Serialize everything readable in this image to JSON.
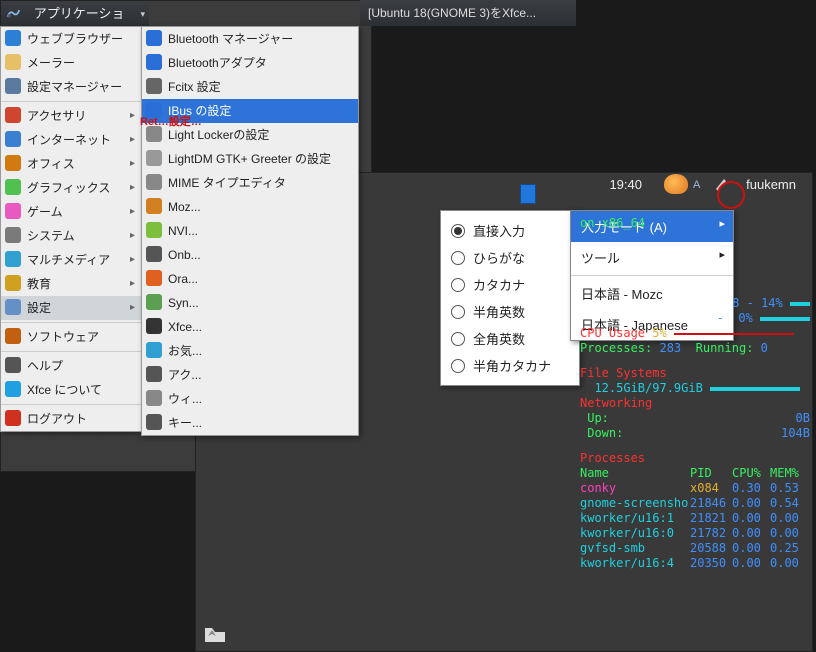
{
  "menubar": {
    "applications_label": "アプリケーション"
  },
  "window_title_1": "[Ubuntu 18(GNOME 3)をXfce...",
  "app_menu": {
    "items": [
      {
        "label": "ウェブブラウザー",
        "has_sub": false
      },
      {
        "label": "メーラー",
        "has_sub": false
      },
      {
        "label": "設定マネージャー",
        "has_sub": false
      },
      {
        "label": "アクセサリ",
        "has_sub": true
      },
      {
        "label": "インターネット",
        "has_sub": true
      },
      {
        "label": "オフィス",
        "has_sub": true
      },
      {
        "label": "グラフィックス",
        "has_sub": true
      },
      {
        "label": "ゲーム",
        "has_sub": true
      },
      {
        "label": "システム",
        "has_sub": true
      },
      {
        "label": "マルチメディア",
        "has_sub": true
      },
      {
        "label": "教育",
        "has_sub": true
      },
      {
        "label": "設定",
        "has_sub": true,
        "selected": true
      },
      {
        "label": "ソフトウェア",
        "has_sub": false
      },
      {
        "label": "ヘルプ",
        "has_sub": false
      },
      {
        "label": "Xfce について",
        "has_sub": false
      },
      {
        "label": "ログアウト",
        "has_sub": false
      }
    ],
    "icon_colors": [
      "#2b7fd4",
      "#e5c067",
      "#5a7aa0",
      "#d04530",
      "#3a80d0",
      "#d07a10",
      "#50c050",
      "#e85ac0",
      "#7a7a7a",
      "#30a0d0",
      "#d0a020",
      "#6590c5",
      "#c06010",
      "#555",
      "#20a0e0",
      "#d03020"
    ]
  },
  "submenu": {
    "items": [
      "Bluetooth マネージャー",
      "Bluetoothアダプタ",
      "Fcitx 設定",
      "IBus の設定",
      "Light Lockerの設定",
      "LightDM GTK+ Greeter の設定",
      "MIME タイプエディタ",
      "Moz...",
      "NVI...",
      "Onb...",
      "Ora...",
      "Syn...",
      "Xfce...",
      "お気...",
      "アク...",
      "ウィ...",
      "キー..."
    ],
    "highlight_index": 3,
    "icon_colors": [
      "#2a6fd8",
      "#2a6fd8",
      "#666",
      "#2a6fd8",
      "#888",
      "#999",
      "#888",
      "#d08020",
      "#7bbf3c",
      "#555",
      "#e06020",
      "#5aa050",
      "#333",
      "#30a0d0",
      "#555",
      "#888",
      "#555"
    ]
  },
  "panel": {
    "clock": "19:40",
    "user": "fuukemn"
  },
  "mozc_modes": {
    "items": [
      "直接入力",
      "ひらがな",
      "カタカナ",
      "半角英数",
      "全角英数",
      "半角カタカナ"
    ],
    "selected_index": 0
  },
  "mozc_menu": {
    "items": [
      {
        "label": "入力モード (A)",
        "has_sub": true,
        "hl": true
      },
      {
        "label": "ツール",
        "has_sub": true
      },
      {
        "label": "日本語 - Mozc"
      },
      {
        "label": "日本語 - Japanese"
      }
    ]
  },
  "conky": {
    "arch": "on x86_64",
    "cpu1": {
      "pct": "14%",
      "range": "8 -"
    },
    "cpu2": {
      "pct": "0%",
      "range": "- "
    },
    "cpu_usage_label": "CPU Usage",
    "cpu_usage_val": "5%",
    "processes_label": "Processes:",
    "processes_val": "283",
    "running_label": "Running:",
    "running_val": "0",
    "fs_header": "File Systems",
    "fs": "12.5GiB/97.9GiB",
    "net_header": "Networking",
    "up_label": "Up:",
    "up_val": "0B",
    "down_label": "Down:",
    "down_val": "104B",
    "proc_header": "Processes",
    "proc_cols": {
      "name": "Name",
      "pid": "PID",
      "cpu": "CPU%",
      "mem": "MEM%"
    },
    "proc_rows": [
      {
        "name": "conky",
        "pid": "x084",
        "cpu": "0.30",
        "mem": "0.53"
      },
      {
        "name": "gnome-screensho",
        "pid": "21846",
        "cpu": "0.00",
        "mem": "0.54"
      },
      {
        "name": "kworker/u16:1",
        "pid": "21821",
        "cpu": "0.00",
        "mem": "0.00"
      },
      {
        "name": "kworker/u16:0",
        "pid": "21782",
        "cpu": "0.00",
        "mem": "0.00"
      },
      {
        "name": "gvfsd-smb",
        "pid": "20588",
        "cpu": "0.00",
        "mem": "0.25"
      },
      {
        "name": "kworker/u16:4",
        "pid": "20350",
        "cpu": "0.00",
        "mem": "0.00"
      }
    ]
  }
}
